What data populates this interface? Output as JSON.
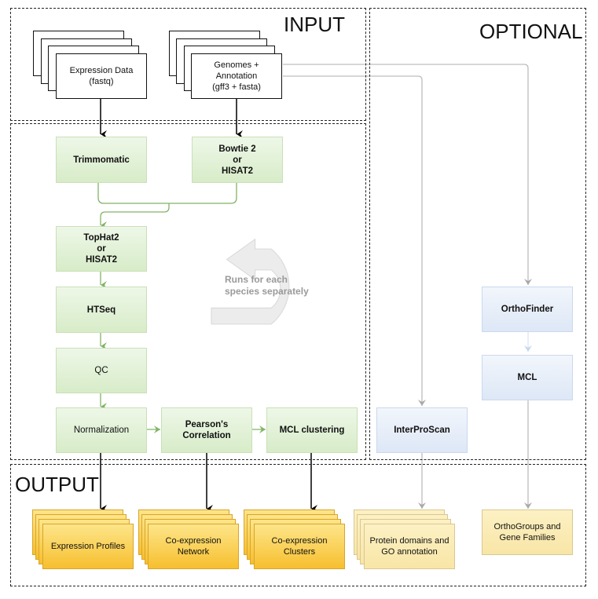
{
  "regions": {
    "input": {
      "title": "INPUT"
    },
    "optional": {
      "title": "OPTIONAL"
    },
    "output": {
      "title": "OUTPUT"
    }
  },
  "inputs": {
    "expression_data": "Expression Data\n(fastq)",
    "genomes": "Genomes +\nAnnotation\n(gff3 + fasta)"
  },
  "pipeline": {
    "trimmomatic": "Trimmomatic",
    "bowtie_hisat": "Bowtie 2\nor\nHISAT2",
    "tophat_hisat": "TopHat2\nor\nHISAT2",
    "htseq": "HTSeq",
    "qc": "QC",
    "normalization": "Normalization",
    "pearson": "Pearson's\nCorrelation",
    "mcl_clustering": "MCL clustering"
  },
  "loop_note": "Runs for each\nspecies separately",
  "optional_tools": {
    "interproscan": "InterProScan",
    "orthofinder": "OrthoFinder",
    "mcl": "MCL"
  },
  "outputs": {
    "expression_profiles": "Expression Profiles",
    "coexpression_network": "Co-expression\nNetwork",
    "coexpression_clusters": "Co-expression\nClusters",
    "protein_domains": "Protein domains and\nGO annotation",
    "orthogroups": "OrthoGroups and\nGene Families"
  },
  "colors": {
    "pipeline_green": "#d7ecc8",
    "pipeline_arrow": "#82b366",
    "optional_blue": "#dde7f6",
    "output_orange": "#f7bf2e",
    "optional_output_cream": "#f8e6a6",
    "optional_arrow": "#b3b3b3"
  }
}
